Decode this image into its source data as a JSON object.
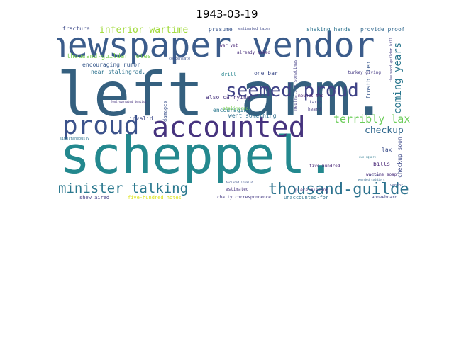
{
  "title": "1943-03-19",
  "words": [
    {
      "text": "left arm.",
      "color": "#35607f"
    },
    {
      "text": "scheppel.",
      "color": "#23888e"
    },
    {
      "text": "newspaper vendor",
      "color": "#3b5c8b"
    },
    {
      "text": "accounted",
      "color": "#46337e"
    },
    {
      "text": "seemed proud",
      "color": "#404387"
    },
    {
      "text": "proud",
      "color": "#3b528b"
    },
    {
      "text": "minister talking",
      "color": "#2a788e"
    },
    {
      "text": "thousand-guilder",
      "color": "#2c728e"
    },
    {
      "text": "inferior wartime",
      "color": "#a0da39"
    },
    {
      "text": "terribly lax",
      "color": "#6ccd5a"
    },
    {
      "text": "coming years",
      "color": "#2a778e"
    },
    {
      "text": "checkup",
      "color": "#31688e"
    },
    {
      "text": "thousand-guilder notes",
      "color": "#7ad151"
    },
    {
      "text": "encouraging rumor",
      "color": "#38598c"
    },
    {
      "text": "near stalingrad.",
      "color": "#2c728e"
    },
    {
      "text": "encouraging",
      "color": "#2a788e"
    },
    {
      "text": "also carrying",
      "color": "#46317e"
    },
    {
      "text": "went something",
      "color": "#2e6e8e"
    },
    {
      "text": "fracture",
      "color": "#3e4a89"
    },
    {
      "text": "presume",
      "color": "#39568c"
    },
    {
      "text": "shaking hands",
      "color": "#2c738e"
    },
    {
      "text": "provide proof",
      "color": "#31688e"
    },
    {
      "text": "estimated taxes",
      "color": "#3f4889"
    },
    {
      "text": "already asked",
      "color": "#472d7b"
    },
    {
      "text": "war yet",
      "color": "#482677"
    },
    {
      "text": "one bar",
      "color": "#3e4c8a"
    },
    {
      "text": "drill",
      "color": "#25848e"
    },
    {
      "text": "invalid",
      "color": "#3e4a89"
    },
    {
      "text": "damages",
      "color": "#3b528b"
    },
    {
      "text": "frostbitten",
      "color": "#38588c"
    },
    {
      "text": "thousand-guilder bill",
      "color": "#433e85"
    },
    {
      "text": "neutrality sometimes",
      "color": "#433e85"
    },
    {
      "text": "turkey giving",
      "color": "#443983"
    },
    {
      "text": "taxes",
      "color": "#404387"
    },
    {
      "text": "heard",
      "color": "#443a83"
    },
    {
      "text": "mounds-the",
      "color": "#481b6d"
    },
    {
      "text": "lax",
      "color": "#3c4f8a"
    },
    {
      "text": "bills",
      "color": "#482576"
    },
    {
      "text": "checkup soon",
      "color": "#3e4a89"
    },
    {
      "text": "wartime soap",
      "color": "#472a7a"
    },
    {
      "text": "five-hundred",
      "color": "#482576"
    },
    {
      "text": "estimated",
      "color": "#46337e"
    },
    {
      "text": "show aired",
      "color": "#433e85"
    },
    {
      "text": "five-hundred notes",
      "color": "#dde318"
    },
    {
      "text": "chatty correspondence",
      "color": "#443983"
    },
    {
      "text": "unaccounted-for",
      "color": "#2c728e"
    },
    {
      "text": "aboveboard",
      "color": "#414487"
    },
    {
      "text": "piece missing",
      "color": "#482475"
    },
    {
      "text": "stalingrad.",
      "color": "#7ad151"
    },
    {
      "text": "compensate",
      "color": "#3b528b"
    },
    {
      "text": "due square",
      "color": "#2a788e"
    },
    {
      "text": "vendor",
      "color": "#3b528b"
    },
    {
      "text": "square",
      "color": "#414487"
    },
    {
      "text": "simultaneously",
      "color": "#2c728e"
    },
    {
      "text": "fool-operated dentist",
      "color": "#46327e"
    },
    {
      "text": "declared invalid",
      "color": "#3b528b"
    },
    {
      "text": "wounded soldiers",
      "color": "#31688e"
    }
  ]
}
